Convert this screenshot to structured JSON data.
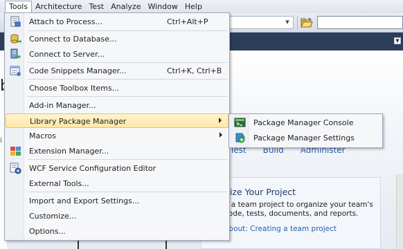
{
  "menubar": {
    "items": [
      "Tools",
      "Architecture",
      "Test",
      "Analyze",
      "Window",
      "Help"
    ]
  },
  "start_page": {
    "nav_links": [
      "Test",
      "Build",
      "Administer"
    ],
    "panel_title": "nize Your Project",
    "panel_line1": "e a team project to organize your team's",
    "panel_line2": "code, tests, documents, and reports.",
    "panel_link": "about: Creating a team project",
    "left_partial_link": "i",
    "left_partial_heading": "b"
  },
  "tools_menu": {
    "items": [
      {
        "label": "Attach to Process...",
        "shortcut": "Ctrl+Alt+P",
        "icon": "attach-process-icon"
      },
      {
        "label": "Connect to Database...",
        "shortcut": "",
        "icon": "connect-database-icon"
      },
      {
        "label": "Connect to Server...",
        "shortcut": "",
        "icon": "connect-server-icon"
      },
      {
        "label": "Code Snippets Manager...",
        "shortcut": "Ctrl+K, Ctrl+B",
        "icon": "code-snippets-icon"
      },
      {
        "label": "Choose Toolbox Items...",
        "shortcut": "",
        "icon": ""
      },
      {
        "label": "Add-in Manager...",
        "shortcut": "",
        "icon": ""
      },
      {
        "label": "Library Package Manager",
        "shortcut": "",
        "icon": ""
      },
      {
        "label": "Macros",
        "shortcut": "",
        "icon": ""
      },
      {
        "label": "Extension Manager...",
        "shortcut": "",
        "icon": "extension-manager-icon"
      },
      {
        "label": "WCF Service Configuration Editor",
        "shortcut": "",
        "icon": "wcf-editor-icon"
      },
      {
        "label": "External Tools...",
        "shortcut": "",
        "icon": ""
      },
      {
        "label": "Import and Export Settings...",
        "shortcut": "",
        "icon": ""
      },
      {
        "label": "Customize...",
        "shortcut": "",
        "icon": ""
      },
      {
        "label": "Options...",
        "shortcut": "",
        "icon": ""
      }
    ]
  },
  "submenu": {
    "items": [
      {
        "label": "Package Manager Console",
        "icon": "package-console-icon"
      },
      {
        "label": "Package Manager Settings",
        "icon": "package-settings-icon"
      }
    ]
  },
  "colors": {
    "highlight": "#ffe8a6",
    "doc_strip": "#2c3d5a",
    "link": "#2a5ba8"
  }
}
